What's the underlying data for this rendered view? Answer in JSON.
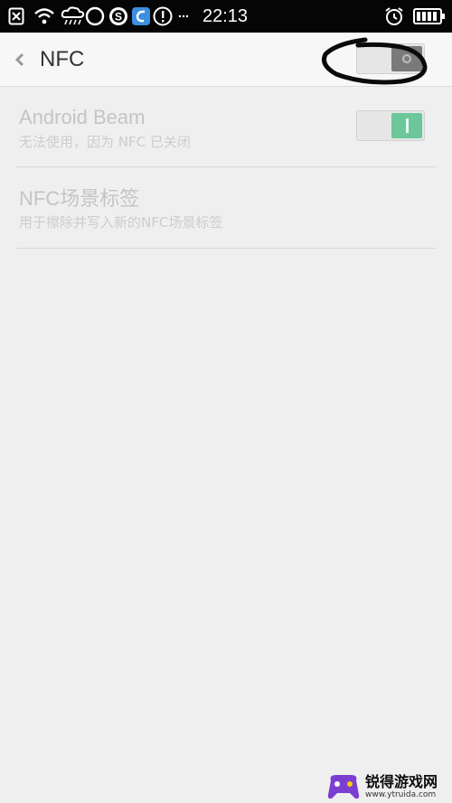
{
  "status_bar": {
    "time": "22:13",
    "icons": [
      "close-box-icon",
      "wifi-icon",
      "cloud-rain-icon",
      "circle-icon",
      "s-app-icon",
      "blue-app-icon",
      "alert-icon",
      "more-icon",
      "alarm-icon",
      "battery-icon"
    ]
  },
  "header": {
    "back_icon": "chevron-left-icon",
    "title": "NFC",
    "toggle_state": "off"
  },
  "settings": [
    {
      "label": "Android Beam",
      "subtitle": "无法使用，因为 NFC 已关闭",
      "toggle_state": "on"
    },
    {
      "label": "NFC场景标签",
      "subtitle": "用于擦除并写入新的NFC场景标签"
    }
  ],
  "watermark": {
    "name": "锐得游戏网",
    "url": "www.ytruida.com"
  },
  "colors": {
    "status_bar": "#050505",
    "header_bg": "#f7f7f7",
    "page_bg": "#efefef",
    "toggle_on": "#6cc79a",
    "toggle_off": "#7a7a7a",
    "disabled_text": "#c4c4c4"
  }
}
